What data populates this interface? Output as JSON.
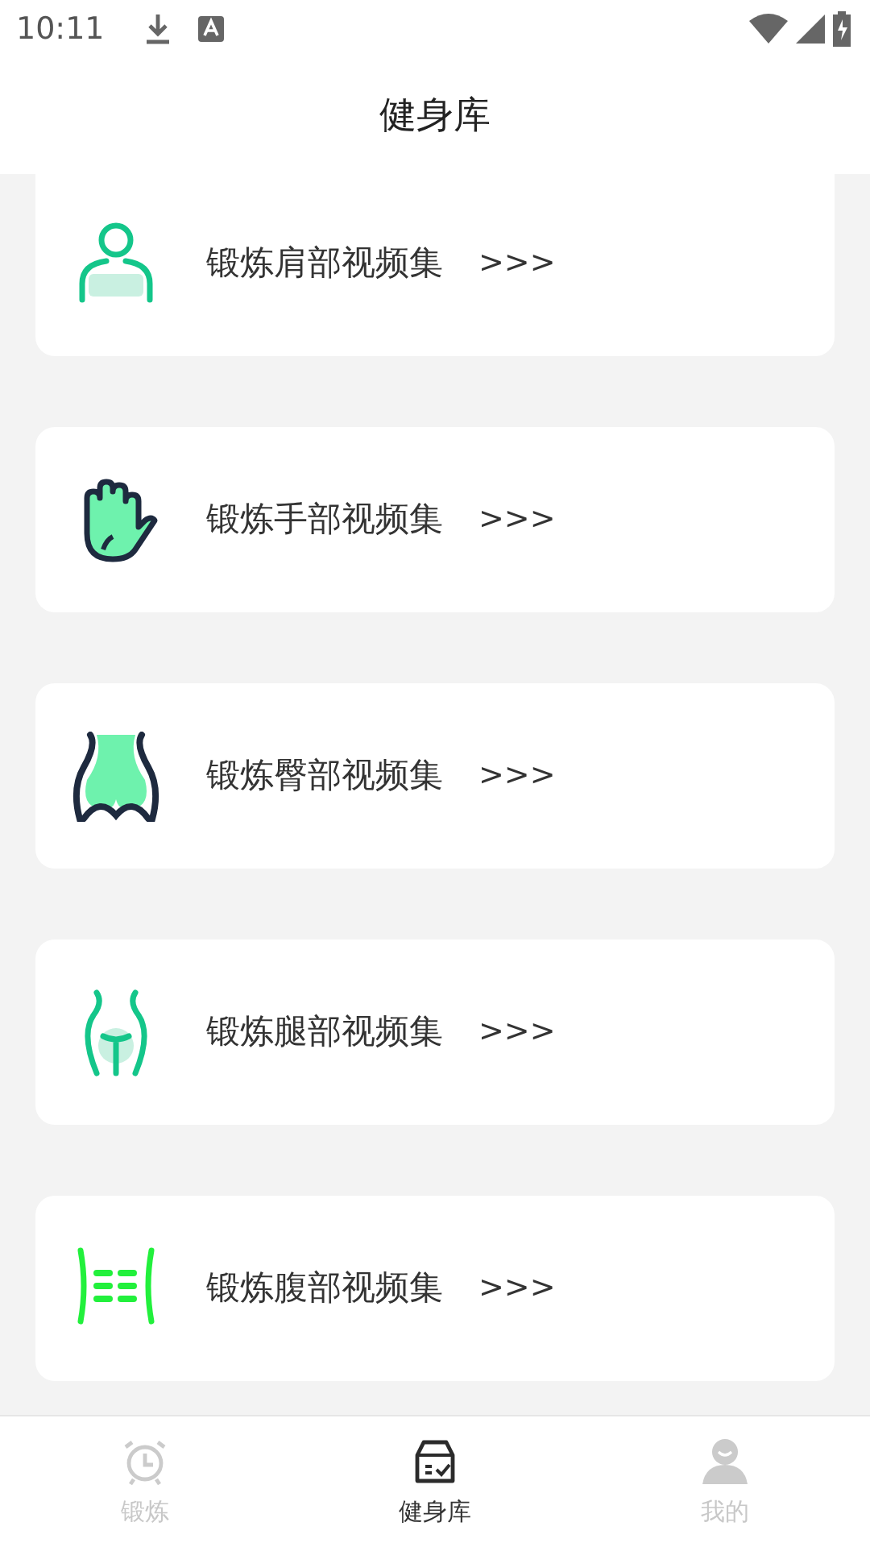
{
  "status_bar": {
    "time": "10:11"
  },
  "header": {
    "title": "健身库"
  },
  "items": [
    {
      "kind": "shoulder",
      "label": "锻炼肩部视频集",
      "arrow": ">>>"
    },
    {
      "kind": "hand",
      "label": "锻炼手部视频集",
      "arrow": ">>>"
    },
    {
      "kind": "hip",
      "label": "锻炼臀部视频集",
      "arrow": ">>>"
    },
    {
      "kind": "leg",
      "label": "锻炼腿部视频集",
      "arrow": ">>>"
    },
    {
      "kind": "abs",
      "label": "锻炼腹部视频集",
      "arrow": ">>>"
    }
  ],
  "tabs": [
    {
      "kind": "clock",
      "label": "锻炼",
      "selected": false
    },
    {
      "kind": "box",
      "label": "健身库",
      "selected": true
    },
    {
      "kind": "person",
      "label": "我的",
      "selected": false
    }
  ]
}
